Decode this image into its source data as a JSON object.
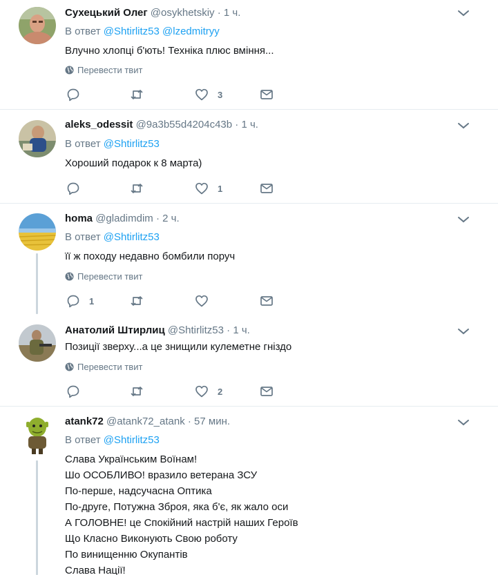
{
  "ui": {
    "reply_prefix": "В ответ",
    "translate_label": "Перевести твит",
    "dot": "·"
  },
  "tweets": [
    {
      "name": "Сухецький Олег",
      "handle": "@osykhetskiy",
      "time": "1 ч.",
      "reply_to": [
        "@Shtirlitz53",
        "@lzedmitryy"
      ],
      "lines": [
        "Влучно хлопці б'ють! Техніка плюс вміння..."
      ],
      "reply_count": "",
      "like_count": "3"
    },
    {
      "name": "aleks_odessit",
      "handle": "@9a3b55d4204c43b",
      "time": "1 ч.",
      "reply_to": [
        "@Shtirlitz53"
      ],
      "lines": [
        "Хороший подарок к 8 марта)"
      ],
      "reply_count": "",
      "like_count": "1"
    },
    {
      "name": "homa",
      "handle": "@gladimdim",
      "time": "2 ч.",
      "reply_to": [
        "@Shtirlitz53"
      ],
      "lines": [
        "її ж походу недавно бомбили поруч"
      ],
      "reply_count": "1",
      "like_count": ""
    },
    {
      "name": "Анатолий Штирлиц",
      "handle": "@Shtirlitz53",
      "time": "1 ч.",
      "reply_to": [],
      "lines": [
        "Позиції зверху...а це знищили кулеметне гніздо"
      ],
      "reply_count": "",
      "like_count": "2"
    },
    {
      "name": "atank72",
      "handle": "@atank72_atank",
      "time": "57 мин.",
      "reply_to": [
        "@Shtirlitz53"
      ],
      "lines": [
        "Слава Українським Воїнам!",
        "Шо ОСОБЛИВО! вразило ветерана ЗСУ",
        "По-перше, надсучасна Оптика",
        "По-друге, Потужна Зброя, яка б'є, як жало оси",
        "А ГОЛОВНЕ! це Спокійний настрій наших Героїв",
        "Що Класно Виконують Свою роботу",
        "По винищенню Окупантів",
        "Слава Нації!"
      ]
    }
  ]
}
